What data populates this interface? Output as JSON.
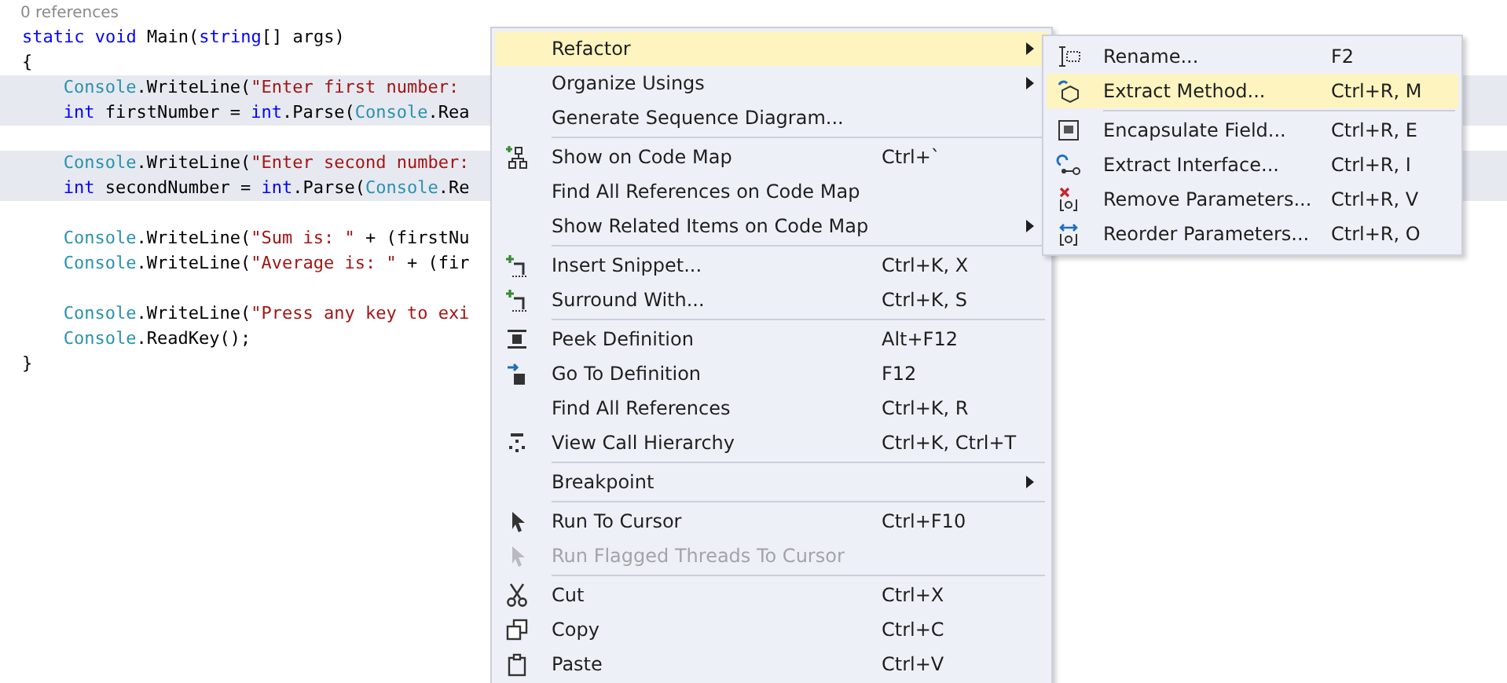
{
  "editor": {
    "codelens": "0 references",
    "lines": [
      {
        "kind": "code",
        "highlighted": false,
        "tokens": [
          {
            "kind": "keyword",
            "text": "static "
          },
          {
            "kind": "keyword",
            "text": "void"
          },
          {
            "kind": "plain",
            "text": " Main("
          },
          {
            "kind": "keyword",
            "text": "string"
          },
          {
            "kind": "plain",
            "text": "[] args)"
          }
        ]
      },
      {
        "kind": "code",
        "highlighted": false,
        "tokens": [
          {
            "kind": "plain",
            "text": "{"
          }
        ]
      },
      {
        "kind": "block",
        "children": [
          {
            "kind": "code",
            "highlighted": true,
            "tokens": [
              {
                "kind": "type",
                "text": "Console"
              },
              {
                "kind": "plain",
                "text": ".WriteLine("
              },
              {
                "kind": "string",
                "text": "\"Enter first number: "
              }
            ]
          },
          {
            "kind": "code",
            "highlighted": true,
            "tokens": [
              {
                "kind": "keyword",
                "text": "int"
              },
              {
                "kind": "plain",
                "text": " firstNumber = "
              },
              {
                "kind": "keyword",
                "text": "int"
              },
              {
                "kind": "plain",
                "text": ".Parse("
              },
              {
                "kind": "type",
                "text": "Console"
              },
              {
                "kind": "plain",
                "text": ".Rea"
              }
            ]
          },
          {
            "kind": "blank"
          },
          {
            "kind": "code",
            "highlighted": true,
            "tokens": [
              {
                "kind": "type",
                "text": "Console"
              },
              {
                "kind": "plain",
                "text": ".WriteLine("
              },
              {
                "kind": "string",
                "text": "\"Enter second number:"
              }
            ]
          },
          {
            "kind": "code",
            "highlighted": true,
            "tokens": [
              {
                "kind": "keyword",
                "text": "int"
              },
              {
                "kind": "plain",
                "text": " secondNumber = "
              },
              {
                "kind": "keyword",
                "text": "int"
              },
              {
                "kind": "plain",
                "text": ".Parse("
              },
              {
                "kind": "type",
                "text": "Console"
              },
              {
                "kind": "plain",
                "text": ".Re"
              }
            ]
          },
          {
            "kind": "blank"
          },
          {
            "kind": "code",
            "highlighted": false,
            "tokens": [
              {
                "kind": "type",
                "text": "Console"
              },
              {
                "kind": "plain",
                "text": ".WriteLine("
              },
              {
                "kind": "string",
                "text": "\"Sum is: \""
              },
              {
                "kind": "plain",
                "text": " + (firstNu"
              }
            ]
          },
          {
            "kind": "code",
            "highlighted": false,
            "tokens": [
              {
                "kind": "type",
                "text": "Console"
              },
              {
                "kind": "plain",
                "text": ".WriteLine("
              },
              {
                "kind": "string",
                "text": "\"Average is: \""
              },
              {
                "kind": "plain",
                "text": " + (fir"
              }
            ]
          },
          {
            "kind": "blank"
          },
          {
            "kind": "code",
            "highlighted": false,
            "tokens": [
              {
                "kind": "type",
                "text": "Console"
              },
              {
                "kind": "plain",
                "text": ".WriteLine("
              },
              {
                "kind": "string",
                "text": "\"Press any key to exi"
              }
            ]
          },
          {
            "kind": "code",
            "highlighted": false,
            "tokens": [
              {
                "kind": "type",
                "text": "Console"
              },
              {
                "kind": "plain",
                "text": ".ReadKey();"
              }
            ]
          }
        ]
      },
      {
        "kind": "code",
        "highlighted": false,
        "tokens": [
          {
            "kind": "plain",
            "text": "}"
          }
        ]
      }
    ]
  },
  "context_menu": {
    "items": [
      {
        "kind": "item",
        "label": "Refactor",
        "submenu": true,
        "selected": true,
        "disabled": false
      },
      {
        "kind": "item",
        "label": "Organize Usings",
        "submenu": true,
        "selected": false,
        "disabled": false
      },
      {
        "kind": "item",
        "label": "Generate Sequence Diagram...",
        "submenu": false,
        "selected": false,
        "disabled": false
      },
      {
        "kind": "separator"
      },
      {
        "kind": "item",
        "label": "Show on Code Map",
        "shortcut": "Ctrl+`",
        "submenu": false,
        "selected": false,
        "disabled": false
      },
      {
        "kind": "item",
        "label": "Find All References on Code Map",
        "submenu": false,
        "selected": false,
        "disabled": false
      },
      {
        "kind": "item",
        "label": "Show Related Items on Code Map",
        "submenu": true,
        "selected": false,
        "disabled": false
      },
      {
        "kind": "separator"
      },
      {
        "kind": "item",
        "label": "Insert Snippet...",
        "shortcut": "Ctrl+K, X",
        "submenu": false,
        "selected": false,
        "disabled": false
      },
      {
        "kind": "item",
        "label": "Surround With...",
        "shortcut": "Ctrl+K, S",
        "submenu": false,
        "selected": false,
        "disabled": false
      },
      {
        "kind": "separator"
      },
      {
        "kind": "item",
        "label": "Peek Definition",
        "shortcut": "Alt+F12",
        "submenu": false,
        "selected": false,
        "disabled": false
      },
      {
        "kind": "item",
        "label": "Go To Definition",
        "shortcut": "F12",
        "submenu": false,
        "selected": false,
        "disabled": false
      },
      {
        "kind": "item",
        "label": "Find All References",
        "shortcut": "Ctrl+K, R",
        "submenu": false,
        "selected": false,
        "disabled": false
      },
      {
        "kind": "item",
        "label": "View Call Hierarchy",
        "shortcut": "Ctrl+K, Ctrl+T",
        "submenu": false,
        "selected": false,
        "disabled": false
      },
      {
        "kind": "separator"
      },
      {
        "kind": "item",
        "label": "Breakpoint",
        "submenu": true,
        "selected": false,
        "disabled": false
      },
      {
        "kind": "separator"
      },
      {
        "kind": "item",
        "label": "Run To Cursor",
        "shortcut": "Ctrl+F10",
        "submenu": false,
        "selected": false,
        "disabled": false
      },
      {
        "kind": "item",
        "label": "Run Flagged Threads To Cursor",
        "submenu": false,
        "selected": false,
        "disabled": true
      },
      {
        "kind": "separator"
      },
      {
        "kind": "item",
        "label": "Cut",
        "shortcut": "Ctrl+X",
        "submenu": false,
        "selected": false,
        "disabled": false
      },
      {
        "kind": "item",
        "label": "Copy",
        "shortcut": "Ctrl+C",
        "submenu": false,
        "selected": false,
        "disabled": false
      },
      {
        "kind": "item",
        "label": "Paste",
        "shortcut": "Ctrl+V",
        "submenu": false,
        "selected": false,
        "disabled": false
      }
    ]
  },
  "refactor_submenu": {
    "items": [
      {
        "kind": "item",
        "label": "Rename...",
        "shortcut": "F2",
        "selected": false
      },
      {
        "kind": "item",
        "label": "Extract Method...",
        "shortcut": "Ctrl+R, M",
        "selected": true
      },
      {
        "kind": "separator"
      },
      {
        "kind": "item",
        "label": "Encapsulate Field...",
        "shortcut": "Ctrl+R, E",
        "selected": false
      },
      {
        "kind": "item",
        "label": "Extract Interface...",
        "shortcut": "Ctrl+R, I",
        "selected": false
      },
      {
        "kind": "item",
        "label": "Remove Parameters...",
        "shortcut": "Ctrl+R, V",
        "selected": false
      },
      {
        "kind": "item",
        "label": "Reorder Parameters...",
        "shortcut": "Ctrl+R, O",
        "selected": false
      }
    ]
  }
}
